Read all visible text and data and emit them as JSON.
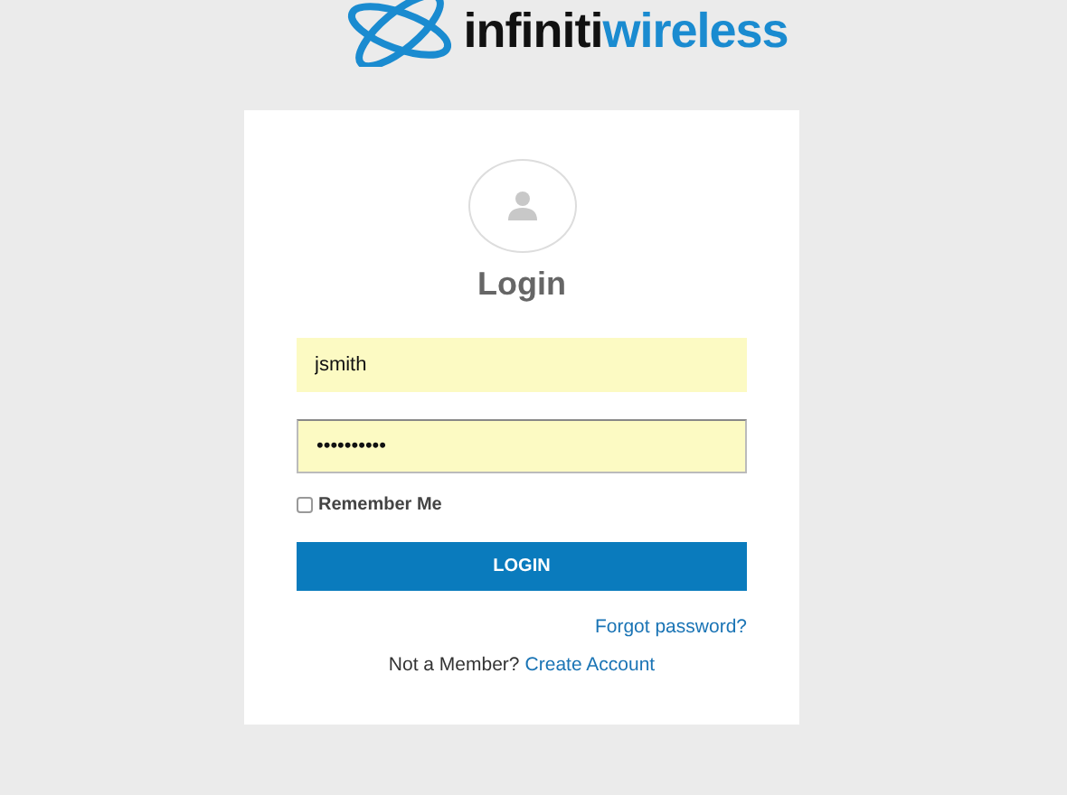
{
  "logo": {
    "part_1": "infiniti",
    "part_2": "wireless"
  },
  "login": {
    "title": "Login",
    "username": {
      "value": "jsmith"
    },
    "password": {
      "value": "••••••••••"
    },
    "remember": {
      "label": "Remember Me",
      "checked": false
    },
    "button": "LOGIN",
    "forgot_link": "Forgot password?",
    "signup_prompt": "Not a Member?",
    "signup_link": "Create Account"
  }
}
